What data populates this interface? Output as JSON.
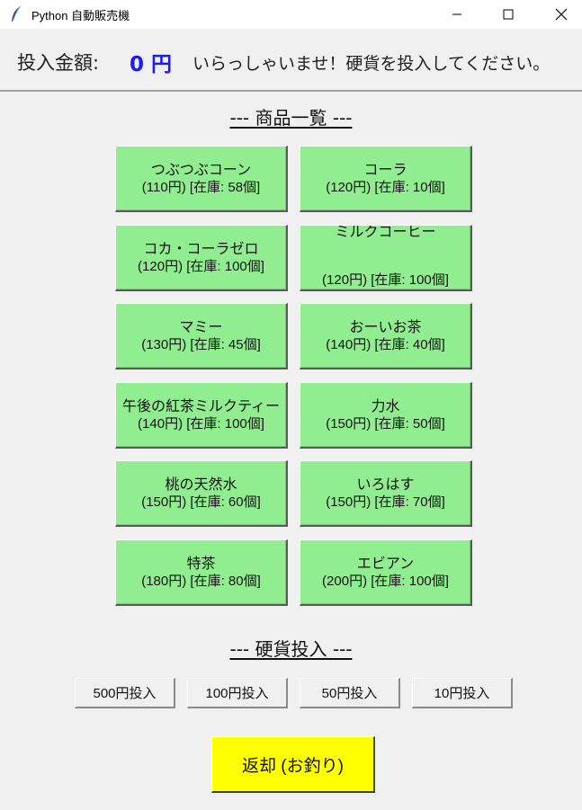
{
  "window": {
    "title": "Python 自動販売機"
  },
  "header": {
    "money_label": "投入金額:",
    "money_value": "0 円",
    "message": "いらっしゃいませ！硬貨を投入してください。"
  },
  "products_title": "--- 商品一覧 ---",
  "products": [
    {
      "name": "つぶつぶコーン",
      "info": "(110円) [在庫: 58個]"
    },
    {
      "name": "コーラ",
      "info": "(120円) [在庫: 10個]"
    },
    {
      "name": "コカ・コーラゼロ",
      "info": "(120円) [在庫: 100個]"
    },
    {
      "name": "ミルクコーヒー",
      "info": "(120円) [在庫: 100個]"
    },
    {
      "name": "マミー",
      "info": "(130円) [在庫: 45個]"
    },
    {
      "name": "おーいお茶",
      "info": "(140円) [在庫: 40個]"
    },
    {
      "name": "午後の紅茶ミルクティー",
      "info": "(140円) [在庫: 100個]"
    },
    {
      "name": "力水",
      "info": "(150円) [在庫: 50個]"
    },
    {
      "name": "桃の天然水",
      "info": "(150円) [在庫: 60個]"
    },
    {
      "name": "いろはす",
      "info": "(150円) [在庫: 70個]"
    },
    {
      "name": "特茶",
      "info": "(180円) [在庫: 80個]"
    },
    {
      "name": "エビアン",
      "info": "(200円) [在庫: 100個]"
    }
  ],
  "coins_title": "--- 硬貨投入 ---",
  "coins": [
    {
      "label": "500円投入"
    },
    {
      "label": "100円投入"
    },
    {
      "label": "50円投入"
    },
    {
      "label": "10円投入"
    }
  ],
  "return_button": "返却 (お釣り)",
  "colors": {
    "product_bg": "#90ee90",
    "money_value": "#1a1aff",
    "return_bg": "#ffff00"
  }
}
